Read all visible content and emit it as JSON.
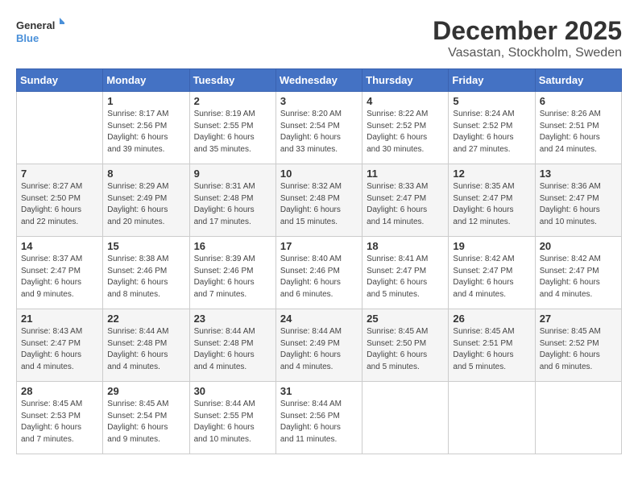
{
  "logo": {
    "line1": "General",
    "line2": "Blue"
  },
  "title": "December 2025",
  "location": "Vasastan, Stockholm, Sweden",
  "header_days": [
    "Sunday",
    "Monday",
    "Tuesday",
    "Wednesday",
    "Thursday",
    "Friday",
    "Saturday"
  ],
  "weeks": [
    [
      {
        "day": "",
        "info": ""
      },
      {
        "day": "1",
        "info": "Sunrise: 8:17 AM\nSunset: 2:56 PM\nDaylight: 6 hours\nand 39 minutes."
      },
      {
        "day": "2",
        "info": "Sunrise: 8:19 AM\nSunset: 2:55 PM\nDaylight: 6 hours\nand 35 minutes."
      },
      {
        "day": "3",
        "info": "Sunrise: 8:20 AM\nSunset: 2:54 PM\nDaylight: 6 hours\nand 33 minutes."
      },
      {
        "day": "4",
        "info": "Sunrise: 8:22 AM\nSunset: 2:52 PM\nDaylight: 6 hours\nand 30 minutes."
      },
      {
        "day": "5",
        "info": "Sunrise: 8:24 AM\nSunset: 2:52 PM\nDaylight: 6 hours\nand 27 minutes."
      },
      {
        "day": "6",
        "info": "Sunrise: 8:26 AM\nSunset: 2:51 PM\nDaylight: 6 hours\nand 24 minutes."
      }
    ],
    [
      {
        "day": "7",
        "info": "Sunrise: 8:27 AM\nSunset: 2:50 PM\nDaylight: 6 hours\nand 22 minutes."
      },
      {
        "day": "8",
        "info": "Sunrise: 8:29 AM\nSunset: 2:49 PM\nDaylight: 6 hours\nand 20 minutes."
      },
      {
        "day": "9",
        "info": "Sunrise: 8:31 AM\nSunset: 2:48 PM\nDaylight: 6 hours\nand 17 minutes."
      },
      {
        "day": "10",
        "info": "Sunrise: 8:32 AM\nSunset: 2:48 PM\nDaylight: 6 hours\nand 15 minutes."
      },
      {
        "day": "11",
        "info": "Sunrise: 8:33 AM\nSunset: 2:47 PM\nDaylight: 6 hours\nand 14 minutes."
      },
      {
        "day": "12",
        "info": "Sunrise: 8:35 AM\nSunset: 2:47 PM\nDaylight: 6 hours\nand 12 minutes."
      },
      {
        "day": "13",
        "info": "Sunrise: 8:36 AM\nSunset: 2:47 PM\nDaylight: 6 hours\nand 10 minutes."
      }
    ],
    [
      {
        "day": "14",
        "info": "Sunrise: 8:37 AM\nSunset: 2:47 PM\nDaylight: 6 hours\nand 9 minutes."
      },
      {
        "day": "15",
        "info": "Sunrise: 8:38 AM\nSunset: 2:46 PM\nDaylight: 6 hours\nand 8 minutes."
      },
      {
        "day": "16",
        "info": "Sunrise: 8:39 AM\nSunset: 2:46 PM\nDaylight: 6 hours\nand 7 minutes."
      },
      {
        "day": "17",
        "info": "Sunrise: 8:40 AM\nSunset: 2:46 PM\nDaylight: 6 hours\nand 6 minutes."
      },
      {
        "day": "18",
        "info": "Sunrise: 8:41 AM\nSunset: 2:47 PM\nDaylight: 6 hours\nand 5 minutes."
      },
      {
        "day": "19",
        "info": "Sunrise: 8:42 AM\nSunset: 2:47 PM\nDaylight: 6 hours\nand 4 minutes."
      },
      {
        "day": "20",
        "info": "Sunrise: 8:42 AM\nSunset: 2:47 PM\nDaylight: 6 hours\nand 4 minutes."
      }
    ],
    [
      {
        "day": "21",
        "info": "Sunrise: 8:43 AM\nSunset: 2:47 PM\nDaylight: 6 hours\nand 4 minutes."
      },
      {
        "day": "22",
        "info": "Sunrise: 8:44 AM\nSunset: 2:48 PM\nDaylight: 6 hours\nand 4 minutes."
      },
      {
        "day": "23",
        "info": "Sunrise: 8:44 AM\nSunset: 2:48 PM\nDaylight: 6 hours\nand 4 minutes."
      },
      {
        "day": "24",
        "info": "Sunrise: 8:44 AM\nSunset: 2:49 PM\nDaylight: 6 hours\nand 4 minutes."
      },
      {
        "day": "25",
        "info": "Sunrise: 8:45 AM\nSunset: 2:50 PM\nDaylight: 6 hours\nand 5 minutes."
      },
      {
        "day": "26",
        "info": "Sunrise: 8:45 AM\nSunset: 2:51 PM\nDaylight: 6 hours\nand 5 minutes."
      },
      {
        "day": "27",
        "info": "Sunrise: 8:45 AM\nSunset: 2:52 PM\nDaylight: 6 hours\nand 6 minutes."
      }
    ],
    [
      {
        "day": "28",
        "info": "Sunrise: 8:45 AM\nSunset: 2:53 PM\nDaylight: 6 hours\nand 7 minutes."
      },
      {
        "day": "29",
        "info": "Sunrise: 8:45 AM\nSunset: 2:54 PM\nDaylight: 6 hours\nand 9 minutes."
      },
      {
        "day": "30",
        "info": "Sunrise: 8:44 AM\nSunset: 2:55 PM\nDaylight: 6 hours\nand 10 minutes."
      },
      {
        "day": "31",
        "info": "Sunrise: 8:44 AM\nSunset: 2:56 PM\nDaylight: 6 hours\nand 11 minutes."
      },
      {
        "day": "",
        "info": ""
      },
      {
        "day": "",
        "info": ""
      },
      {
        "day": "",
        "info": ""
      }
    ]
  ]
}
